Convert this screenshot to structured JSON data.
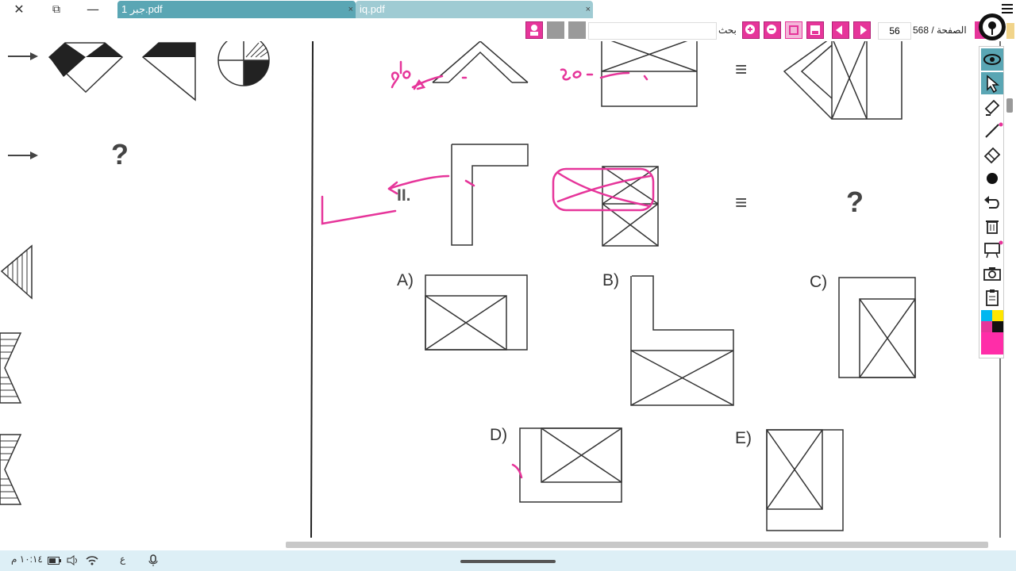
{
  "tabs": [
    {
      "title": "جبر 1.pdf",
      "close": "×"
    },
    {
      "title": "iq.pdf",
      "close": "×"
    }
  ],
  "toolbar": {
    "search_label": "بحث",
    "page_label": "الصفحة",
    "page_total": "568 /",
    "page_current": "56"
  },
  "document": {
    "left_column": {
      "question_mark": "?"
    },
    "question": {
      "number": "II.",
      "equals_top": "≡",
      "equals_bottom": "≡",
      "unknown": "?"
    },
    "options": [
      {
        "label": "A)"
      },
      {
        "label": "B)"
      },
      {
        "label": "C)"
      },
      {
        "label": "D)"
      },
      {
        "label": "E)"
      }
    ],
    "handwriting": {
      "degrees_left": "90",
      "degrees_right": "90"
    }
  },
  "tools": [
    "eye-icon",
    "pointer-icon",
    "highlighter-icon",
    "pen-icon",
    "eraser-icon",
    "dot-icon",
    "undo-icon",
    "trash-icon",
    "board-icon",
    "camera-icon",
    "clipboard-icon",
    "color-palette-icon"
  ],
  "colors": {
    "annotation": "#e6359a",
    "tab_active": "#5aa6b4",
    "tab_inactive": "#9fcbd3",
    "status_bar": "#ddeff6"
  },
  "statusbar": {
    "time": "١٠:١٤ م",
    "keyboard": "ع"
  }
}
